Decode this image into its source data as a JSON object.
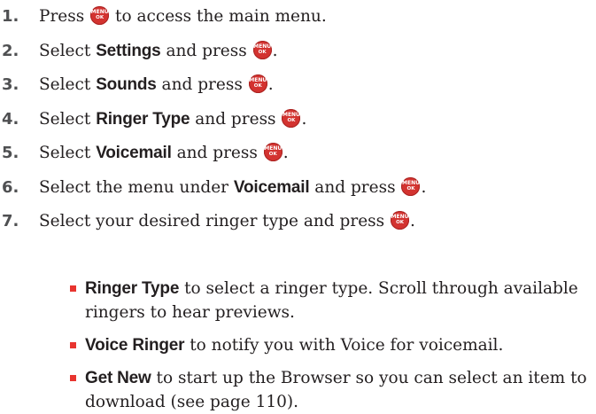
{
  "steps": [
    {
      "number": "1.",
      "text_before": "Press",
      "keyword": "",
      "text_after": "to access the main menu.",
      "key": "menu-ok"
    },
    {
      "number": "2.",
      "text_before": "Select",
      "keyword": "Settings",
      "text_after": "and press",
      "key": "menu-ok"
    },
    {
      "number": "3.",
      "text_before": "Select",
      "keyword": "Sounds",
      "text_after": "and press",
      "key": "menu-ok"
    },
    {
      "number": "4.",
      "text_before": "Select",
      "keyword": "Ringer Type",
      "text_after": "and press",
      "key": "menu-ok"
    },
    {
      "number": "5.",
      "text_before": "Select",
      "keyword": "Voicemail",
      "text_after": "and press",
      "key": "menu-ok"
    },
    {
      "number": "6.",
      "text_before": "Select the menu under",
      "keyword": "Voicemail",
      "text_after": "and press",
      "key": "menu-ok"
    },
    {
      "number": "7.",
      "text_before": "Select your desired ringer type and press",
      "keyword": "",
      "text_after": "",
      "key": "menu-ok"
    }
  ],
  "key_icon": {
    "line1": "MENU",
    "line2": "OK",
    "color": "#d33330"
  },
  "bullets": [
    {
      "keyword": "Ringer Type",
      "text": "to select a ringer type. Scroll through available ringers to hear previews."
    },
    {
      "keyword": "Voice Ringer",
      "text": "to notify you with Voice for voicemail."
    },
    {
      "keyword": "Get New",
      "text": "to start up the Browser so you can select an item to download (see page 110)."
    }
  ],
  "colors": {
    "bullet": "#e8342f",
    "step_number": "#4f5052",
    "text": "#231f20"
  }
}
